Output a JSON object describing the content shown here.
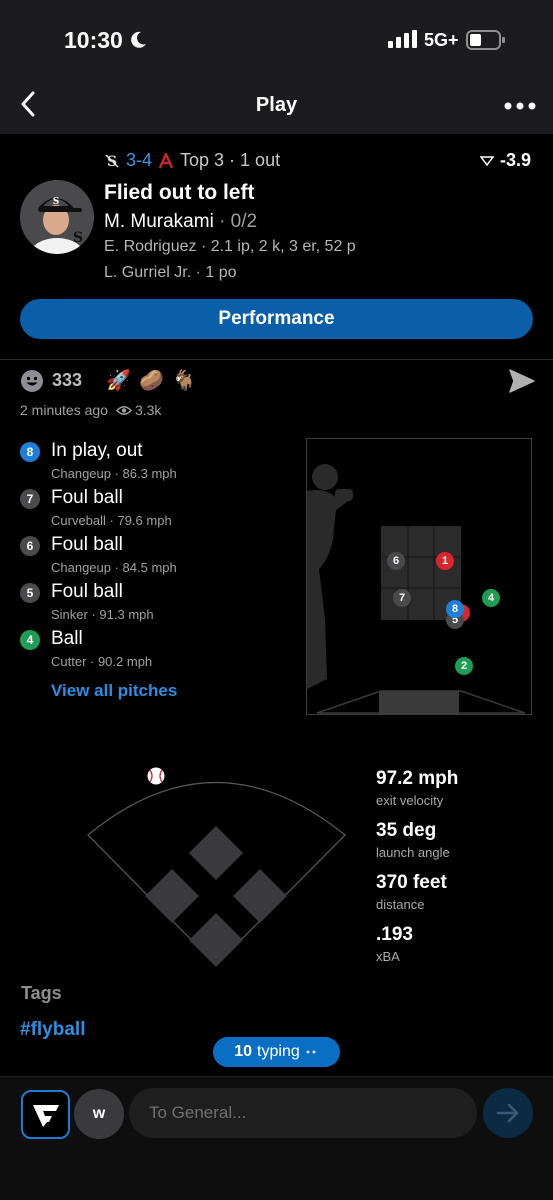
{
  "status_bar": {
    "time": "10:30",
    "network": "5G+"
  },
  "nav": {
    "title": "Play"
  },
  "play": {
    "score": "3-4",
    "inning": "Top 3 · 1 out",
    "win_prob_delta": "-3.9",
    "title": "Flied out to left",
    "batter": "M. Murakami",
    "batter_line": " · 0/2",
    "pitcher_line": "E. Rodriguez · 2.1 ip, 2 k, 3 er, 52 p",
    "fielder_line": "L. Gurriel Jr. · 1 po",
    "performance_label": "Performance"
  },
  "reactions": {
    "count": "333",
    "emojis": [
      "🚀",
      "🥔",
      "🐐"
    ],
    "time_ago": "2 minutes ago",
    "views": "3.3k"
  },
  "pitches": [
    {
      "number": "8",
      "result": "In play, out",
      "detail": "Changeup · 86.3 mph",
      "color": "#1e7fd8"
    },
    {
      "number": "7",
      "result": "Foul ball",
      "detail": "Curveball · 79.6 mph",
      "color": "#4a4a4c"
    },
    {
      "number": "6",
      "result": "Foul ball",
      "detail": "Changeup · 84.5 mph",
      "color": "#4a4a4c"
    },
    {
      "number": "5",
      "result": "Foul ball",
      "detail": "Sinker · 91.3 mph",
      "color": "#4a4a4c"
    },
    {
      "number": "4",
      "result": "Ball",
      "detail": "Cutter · 90.2 mph",
      "color": "#1f9d55"
    }
  ],
  "view_all_label": "View all pitches",
  "zone_pitches": [
    {
      "number": "6",
      "color": "#4a4a4c"
    },
    {
      "number": "1",
      "color": "#d9262c"
    },
    {
      "number": "7",
      "color": "#4a4a4c"
    },
    {
      "number": "4",
      "color": "#1f9d55"
    },
    {
      "number": "5",
      "color": "#4a4a4c"
    },
    {
      "number": "8",
      "color": "#1e7fd8"
    },
    {
      "number": "2",
      "color": "#1f9d55"
    }
  ],
  "batted_ball": [
    {
      "value": "97.2 mph",
      "label": "exit velocity"
    },
    {
      "value": "35 deg",
      "label": "launch angle"
    },
    {
      "value": "370 feet",
      "label": "distance"
    },
    {
      "value": ".193",
      "label": "xBA"
    }
  ],
  "tags": {
    "heading": "Tags",
    "items": [
      "#flyball"
    ]
  },
  "typing": {
    "count": "10",
    "label": "typing"
  },
  "composer": {
    "user_initial": "w",
    "placeholder": "To General..."
  }
}
